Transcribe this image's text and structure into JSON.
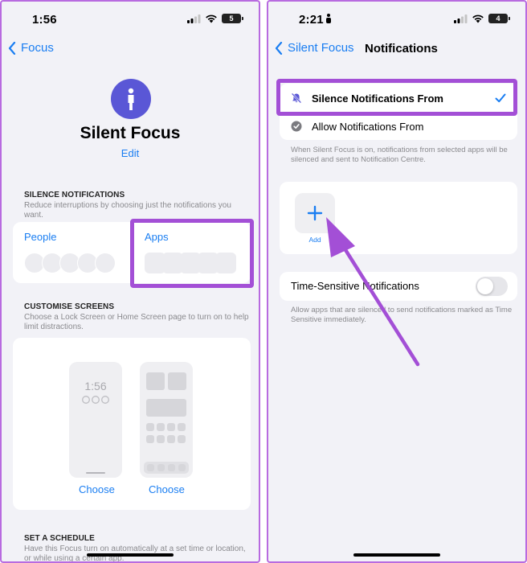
{
  "left_screen": {
    "status": {
      "time": "1:56",
      "battery": "5"
    },
    "nav": {
      "back_label": "Focus"
    },
    "focus_name": "Silent Focus",
    "edit_label": "Edit",
    "silence_section": {
      "heading": "SILENCE NOTIFICATIONS",
      "description": "Reduce interruptions by choosing just the notifications you want.",
      "people_label": "People",
      "apps_label": "Apps"
    },
    "customise_section": {
      "heading": "CUSTOMISE SCREENS",
      "description": "Choose a Lock Screen or Home Screen page to turn on to help limit distractions.",
      "lock_preview_time": "1:56",
      "choose_lock_label": "Choose",
      "choose_home_label": "Choose"
    },
    "schedule_section": {
      "heading": "SET A SCHEDULE",
      "description": "Have this Focus turn on automatically at a set time or location, or while using a certain app."
    }
  },
  "right_screen": {
    "status": {
      "time": "2:21",
      "battery": "4"
    },
    "nav": {
      "back_label": "Silent Focus",
      "title": "Notifications"
    },
    "options": [
      {
        "label": "Silence Notifications From",
        "selected": true
      },
      {
        "label": "Allow Notifications From",
        "selected": false
      }
    ],
    "options_note": "When Silent Focus is on, notifications from selected apps will be silenced and sent to Notification Centre.",
    "add_label": "Add",
    "time_sensitive": {
      "label": "Time-Sensitive Notifications",
      "enabled": false,
      "note": "Allow apps that are silenced to send notifications marked as Time Sensitive immediately."
    }
  },
  "colors": {
    "accent": "#1a7ef2",
    "highlight": "#a34fd6",
    "focus_icon": "#5a57d6",
    "background": "#f2f2f7"
  }
}
